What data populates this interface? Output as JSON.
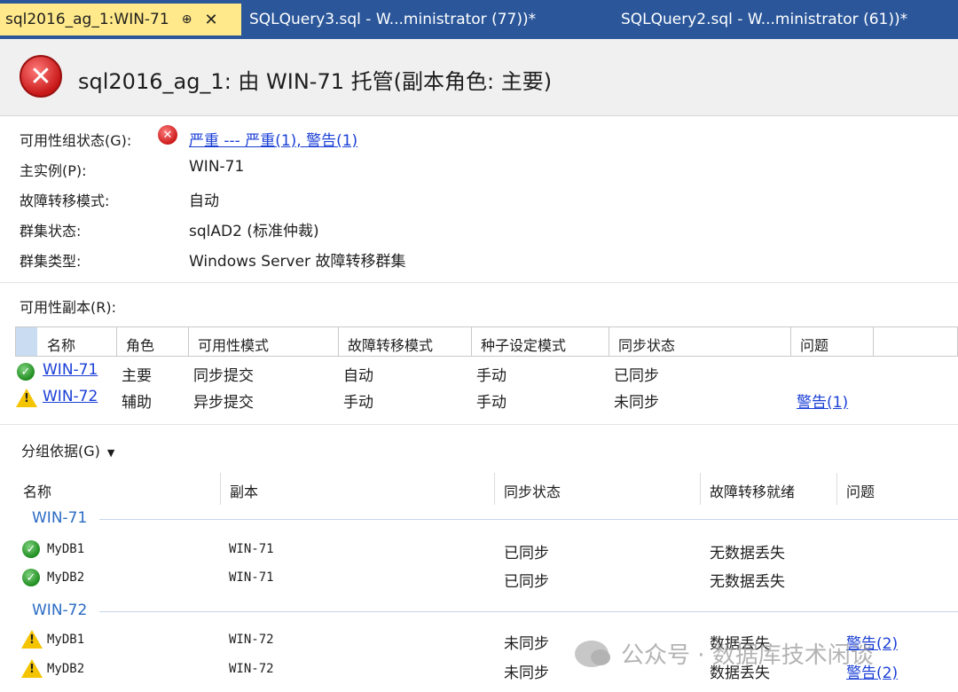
{
  "tabs": [
    {
      "label": "sql2016_ag_1:WIN-71",
      "pin": "⊕",
      "close": "✕"
    },
    {
      "label": "SQLQuery3.sql - W...ministrator (77))*"
    },
    {
      "label": "SQLQuery2.sql - W...ministrator (61))*"
    }
  ],
  "header": {
    "title": "sql2016_ag_1: 由 WIN-71 托管(副本角色: 主要)"
  },
  "properties": {
    "ag_status_label": "可用性组状态(G):",
    "ag_status_value": "严重 --- 严重(1), 警告(1)",
    "primary_label": "主实例(P):",
    "primary_value": "WIN-71",
    "failover_label": "故障转移模式:",
    "failover_value": "自动",
    "cluster_state_label": "群集状态:",
    "cluster_state_value": "sqlAD2 (标准仲裁)",
    "cluster_type_label": "群集类型:",
    "cluster_type_value": "Windows Server 故障转移群集"
  },
  "replicas": {
    "section_label": "可用性副本(R):",
    "columns": [
      "名称",
      "角色",
      "可用性模式",
      "故障转移模式",
      "种子设定模式",
      "同步状态",
      "问题"
    ],
    "rows": [
      {
        "status": "ok",
        "name": "WIN-71",
        "role": "主要",
        "availability": "同步提交",
        "failover": "自动",
        "seeding": "手动",
        "sync": "已同步",
        "issue": ""
      },
      {
        "status": "warning",
        "name": "WIN-72",
        "role": "辅助",
        "availability": "异步提交",
        "failover": "手动",
        "seeding": "手动",
        "sync": "未同步",
        "issue": "警告(1)"
      }
    ]
  },
  "databases": {
    "group_by_label": "分组依据(G)",
    "columns": [
      "名称",
      "副本",
      "同步状态",
      "故障转移就绪",
      "问题"
    ],
    "groups": [
      {
        "title": "WIN-71",
        "rows": [
          {
            "status": "ok",
            "name": "MyDB1",
            "replica": "WIN-71",
            "sync": "已同步",
            "ready": "无数据丢失",
            "issue": ""
          },
          {
            "status": "ok",
            "name": "MyDB2",
            "replica": "WIN-71",
            "sync": "已同步",
            "ready": "无数据丢失",
            "issue": ""
          }
        ]
      },
      {
        "title": "WIN-72",
        "rows": [
          {
            "status": "warning",
            "name": "MyDB1",
            "replica": "WIN-72",
            "sync": "未同步",
            "ready": "数据丢失",
            "issue": "警告(2)"
          },
          {
            "status": "warning",
            "name": "MyDB2",
            "replica": "WIN-72",
            "sync": "未同步",
            "ready": "数据丢失",
            "issue": "警告(2)"
          }
        ]
      }
    ]
  },
  "watermark": "公众号 · 数据库技术闲谈",
  "colors": {
    "tabbar": "#2b579a",
    "active_tab": "#ffe98a",
    "link": "#1a3fd6",
    "group_title": "#2b6cc4",
    "error": "#c81818",
    "ok": "#1f8d1f",
    "warning": "#f5c400"
  }
}
